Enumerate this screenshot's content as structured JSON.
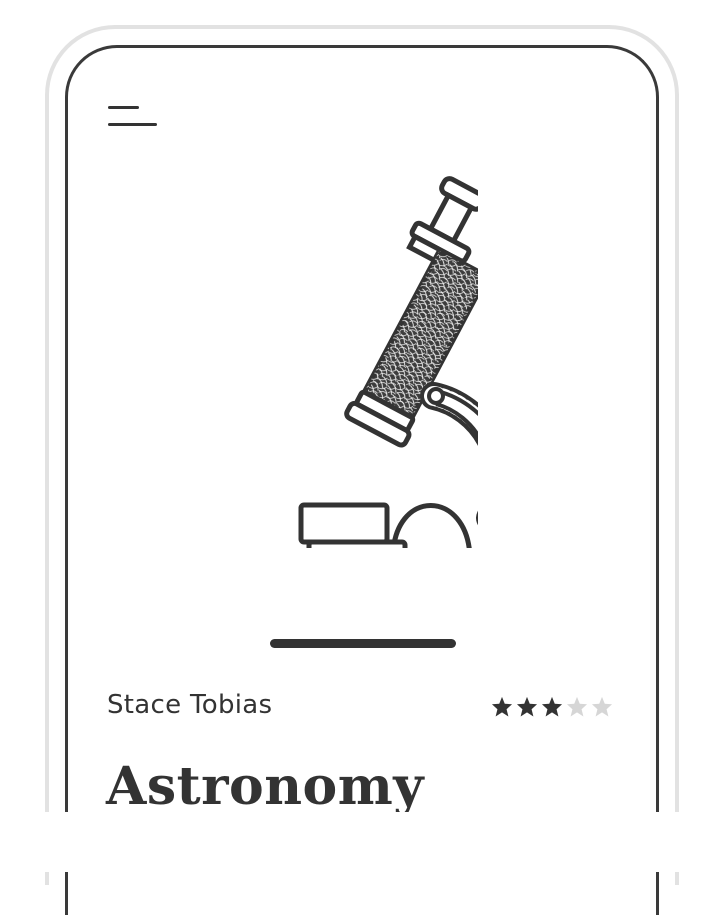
{
  "menu": {
    "icon": "hamburger-menu-icon"
  },
  "hero": {
    "icon": "microscope-icon"
  },
  "course": {
    "author": "Stace Tobias",
    "title": "Astronomy",
    "rating": {
      "value": 3,
      "max": 5
    }
  },
  "colors": {
    "ink": "#333333",
    "star_filled": "#333333",
    "star_empty": "#d6d6d6",
    "device_frame": "#e2e2e2"
  }
}
